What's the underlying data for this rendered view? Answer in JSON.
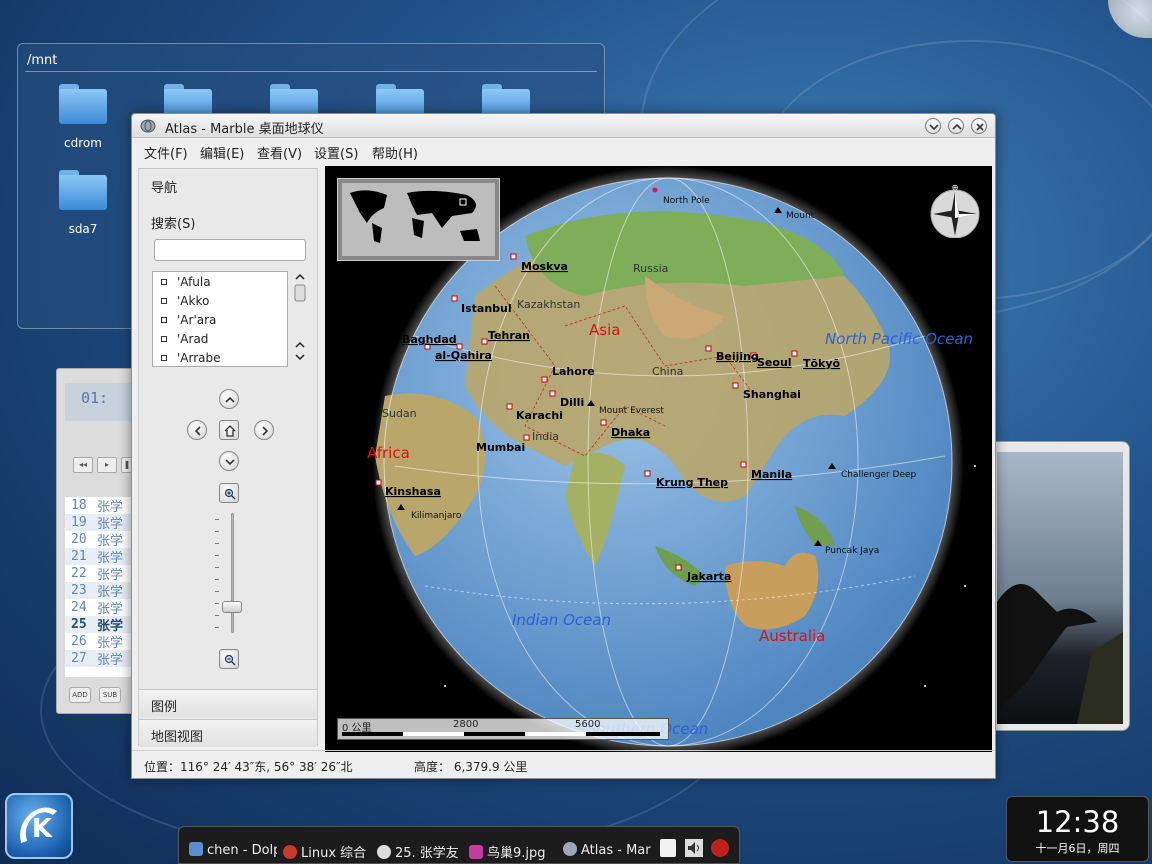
{
  "desktop": {
    "folder_window": {
      "path": "/mnt",
      "folders": [
        "cdrom",
        "sda7"
      ]
    },
    "player": {
      "lcd_time": "01:",
      "tracks": [
        {
          "num": "18",
          "title": "张学"
        },
        {
          "num": "19",
          "title": "张学"
        },
        {
          "num": "20",
          "title": "张学"
        },
        {
          "num": "21",
          "title": "张学"
        },
        {
          "num": "22",
          "title": "张学"
        },
        {
          "num": "23",
          "title": "张学"
        },
        {
          "num": "24",
          "title": "张学"
        },
        {
          "num": "25",
          "title": "张学"
        },
        {
          "num": "26",
          "title": "张学"
        },
        {
          "num": "27",
          "title": "张学"
        }
      ],
      "current_track": "25",
      "buttons": {
        "add": "ADD",
        "sub": "SUB"
      }
    }
  },
  "window": {
    "title": "Atlas - Marble 桌面地球仪",
    "menu": [
      "文件(F)",
      "编辑(E)",
      "查看(V)",
      "设置(S)",
      "帮助(H)"
    ]
  },
  "sidebar": {
    "section_title": "导航",
    "search_label": "搜索(S)",
    "search_value": "",
    "cities": [
      "'Afula",
      "'Akko",
      "'Ar'ara",
      "'Arad",
      "'Arrabe"
    ],
    "panels": [
      "图例",
      "地图视图"
    ]
  },
  "map": {
    "continents": [
      "Asia",
      "Africa",
      "Australia"
    ],
    "oceans": [
      "North Pacific Ocean",
      "Indian Ocean",
      "Southern Ocean"
    ],
    "regions": [
      "Russia",
      "Kazakhstan",
      "China",
      "India",
      "Sudan"
    ],
    "cities": [
      "Moskva",
      "Istanbul",
      "Baghdad",
      "al-Qahira",
      "Tehran",
      "Lahore",
      "Karachi",
      "Dilli",
      "Mumbai",
      "Dhaka",
      "Beijing",
      "Seoul",
      "Tōkyō",
      "Shanghai",
      "Krung Thep",
      "Manila",
      "Jakarta",
      "Kinshasa"
    ],
    "peaks": [
      "North Pole",
      "Mount Everest",
      "Kilimanjaro",
      "Challenger Deep",
      "Puncak Jaya",
      "Mount"
    ],
    "scale": {
      "labels": [
        "0 公里",
        "2800",
        "5600"
      ]
    }
  },
  "status": {
    "position": "位置：116° 24′ 43″东, 56° 38′ 26″北",
    "altitude": "高度： 6,379.9 公里"
  },
  "taskbar": {
    "tasks": [
      "chen - Dolp",
      "Linux 综合",
      "25. 张学友",
      "鸟巢9.jpg -",
      "Atlas - Marb"
    ]
  },
  "clock": {
    "time": "12:38",
    "date": "十一月6日，周四"
  },
  "colors": {
    "accent": "#1f4f86",
    "continent_label": "#d41414",
    "ocean_label": "#2b62d6"
  }
}
